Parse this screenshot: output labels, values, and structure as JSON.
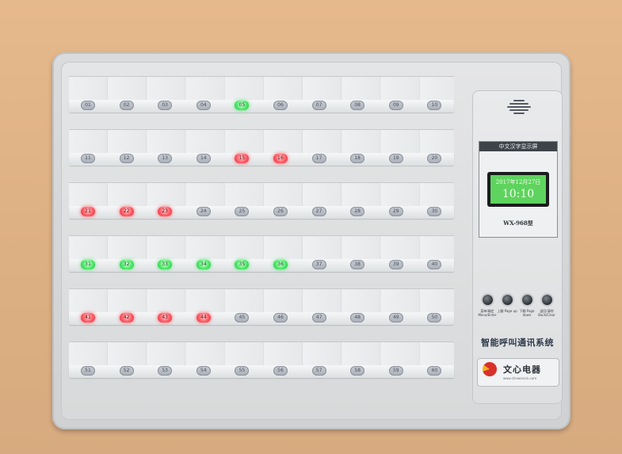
{
  "device": {
    "screen_title": "中文汉字显示屏",
    "date": "2017年12月27日",
    "time": "10:10",
    "model": "WX-968型",
    "system_title": "智能呼叫通讯系统",
    "brand_name": "文心电器",
    "brand_url": "www.chnwenxin.com",
    "buttons": [
      {
        "label": "菜单/确定 Menu/Enter"
      },
      {
        "label": "上翻 Page up"
      },
      {
        "label": "下翻 Page down"
      },
      {
        "label": "返回/清除 Back/Clear"
      }
    ]
  },
  "rows": [
    {
      "keys": [
        {
          "label": "01",
          "state": "off"
        },
        {
          "label": "02",
          "state": "off"
        },
        {
          "label": "03",
          "state": "off"
        },
        {
          "label": "04",
          "state": "off"
        },
        {
          "label": "05",
          "state": "green"
        },
        {
          "label": "06",
          "state": "off"
        },
        {
          "label": "07",
          "state": "off"
        },
        {
          "label": "08",
          "state": "off"
        },
        {
          "label": "09",
          "state": "off"
        },
        {
          "label": "10",
          "state": "off"
        }
      ]
    },
    {
      "keys": [
        {
          "label": "11",
          "state": "off"
        },
        {
          "label": "12",
          "state": "off"
        },
        {
          "label": "13",
          "state": "off"
        },
        {
          "label": "14",
          "state": "off"
        },
        {
          "label": "15",
          "state": "red"
        },
        {
          "label": "16",
          "state": "red"
        },
        {
          "label": "17",
          "state": "off"
        },
        {
          "label": "18",
          "state": "off"
        },
        {
          "label": "19",
          "state": "off"
        },
        {
          "label": "20",
          "state": "off"
        }
      ]
    },
    {
      "keys": [
        {
          "label": "21",
          "state": "red"
        },
        {
          "label": "22",
          "state": "red"
        },
        {
          "label": "23",
          "state": "red"
        },
        {
          "label": "24",
          "state": "off"
        },
        {
          "label": "25",
          "state": "off"
        },
        {
          "label": "26",
          "state": "off"
        },
        {
          "label": "27",
          "state": "off"
        },
        {
          "label": "28",
          "state": "off"
        },
        {
          "label": "29",
          "state": "off"
        },
        {
          "label": "30",
          "state": "off"
        }
      ]
    },
    {
      "keys": [
        {
          "label": "31",
          "state": "green"
        },
        {
          "label": "32",
          "state": "green"
        },
        {
          "label": "33",
          "state": "green"
        },
        {
          "label": "34",
          "state": "green"
        },
        {
          "label": "35",
          "state": "green"
        },
        {
          "label": "36",
          "state": "green"
        },
        {
          "label": "37",
          "state": "off"
        },
        {
          "label": "38",
          "state": "off"
        },
        {
          "label": "39",
          "state": "off"
        },
        {
          "label": "40",
          "state": "off"
        }
      ]
    },
    {
      "keys": [
        {
          "label": "41",
          "state": "red"
        },
        {
          "label": "42",
          "state": "red"
        },
        {
          "label": "43",
          "state": "red"
        },
        {
          "label": "44",
          "state": "red"
        },
        {
          "label": "45",
          "state": "off"
        },
        {
          "label": "46",
          "state": "off"
        },
        {
          "label": "47",
          "state": "off"
        },
        {
          "label": "48",
          "state": "off"
        },
        {
          "label": "49",
          "state": "off"
        },
        {
          "label": "50",
          "state": "off"
        }
      ]
    },
    {
      "keys": [
        {
          "label": "51",
          "state": "off"
        },
        {
          "label": "52",
          "state": "off"
        },
        {
          "label": "53",
          "state": "off"
        },
        {
          "label": "54",
          "state": "off"
        },
        {
          "label": "55",
          "state": "off"
        },
        {
          "label": "56",
          "state": "off"
        },
        {
          "label": "57",
          "state": "off"
        },
        {
          "label": "58",
          "state": "off"
        },
        {
          "label": "59",
          "state": "off"
        },
        {
          "label": "60",
          "state": "off"
        }
      ]
    }
  ]
}
